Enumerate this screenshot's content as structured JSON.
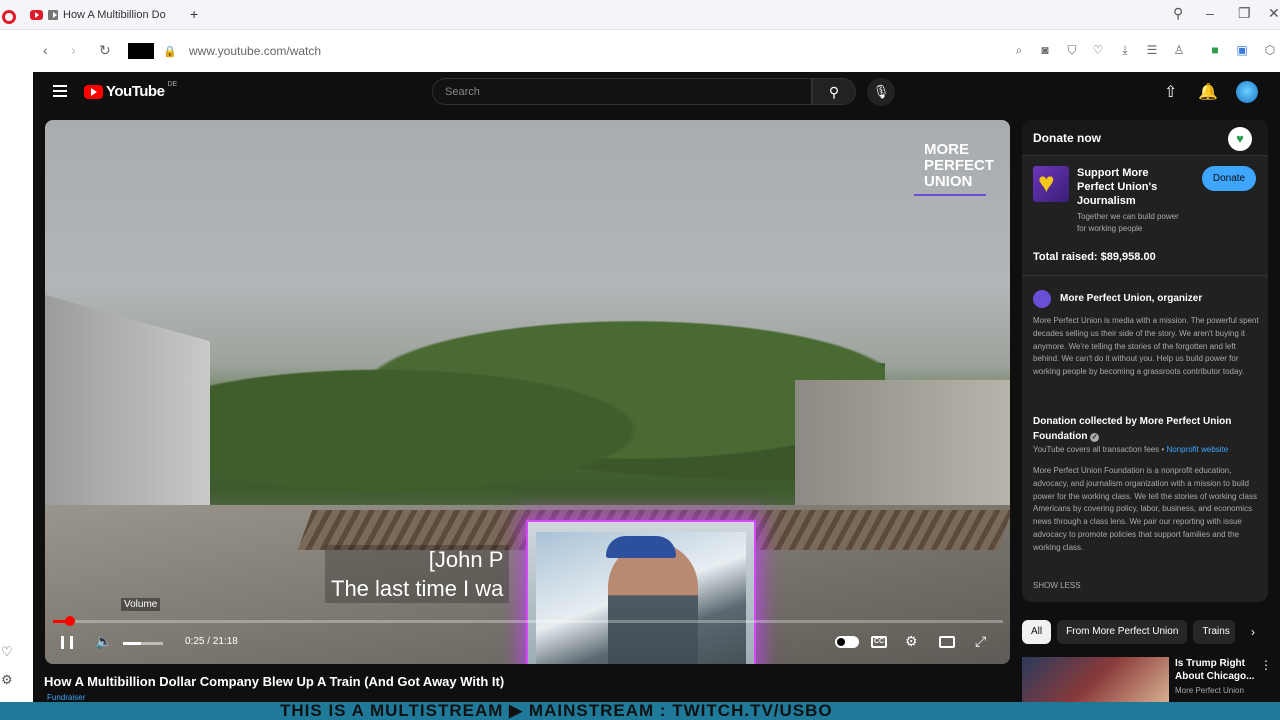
{
  "browser": {
    "tab_title": "How A Multibillion Do",
    "new_tab": "+",
    "url": "www.youtube.com/watch"
  },
  "youtube": {
    "logo_text": "YouTube",
    "logo_country": "DE",
    "search_placeholder": "Search"
  },
  "video": {
    "watermark_line1": "MORE",
    "watermark_line2": "PERFECT",
    "watermark_line3": "UNION",
    "caption_line1": "[John P",
    "caption_line2": "The last time I wa",
    "volume_tooltip": "Volume",
    "time": "0:25 / 21:18",
    "progress_fraction": 0.02,
    "volume_fraction": 0.45,
    "cc_label": "CC",
    "title": "How A Multibillion Dollar Company Blew Up A Train (And Got Away With It)",
    "fundraiser_label": "Fundraiser"
  },
  "donate": {
    "header": "Donate now",
    "campaign": "Support More Perfect Union's Journalism",
    "tagline": "Together we can build power for working people",
    "button": "Donate",
    "total": "Total raised: $89,958.00",
    "organizer": "More Perfect Union, organizer",
    "organizer_desc": "More Perfect Union is media with a mission. The powerful spent decades selling us their side of the story. We aren't buying it anymore. We're telling the stories of the forgotten and left behind. We can't do it without you. Help us build power for working people by becoming a grassroots contributor today.",
    "collected_by": "Donation collected by More Perfect Union Foundation",
    "fees_text": "YouTube covers all transaction fees",
    "fees_sep": "•",
    "nonprofit_link": "Nonprofit website",
    "foundation_desc": "More Perfect Union Foundation is a nonprofit education, advocacy, and journalism organization with a mission to build power for the working class. We tell the stories of working class Americans by covering policy, labor, business, and economics news through a class lens. We pair our reporting with issue advocacy to promote policies that support families and the working class.",
    "show_less": "SHOW LESS"
  },
  "chips": [
    "All",
    "From More Perfect Union",
    "Trains"
  ],
  "recommendation": {
    "title": "Is Trump Right About Chicago...",
    "channel": "More Perfect Union"
  },
  "banner": "THIS IS A MULTISTREAM   ▶   MAINSTREAM : TWITCH.TV/USBO",
  "banner_arrow": "▶",
  "colors": {
    "accent_red": "#ff0000",
    "donate_blue": "#3ea6ff",
    "webcam_glow": "#d44bff",
    "banner_bg": "#1f7a9a"
  }
}
